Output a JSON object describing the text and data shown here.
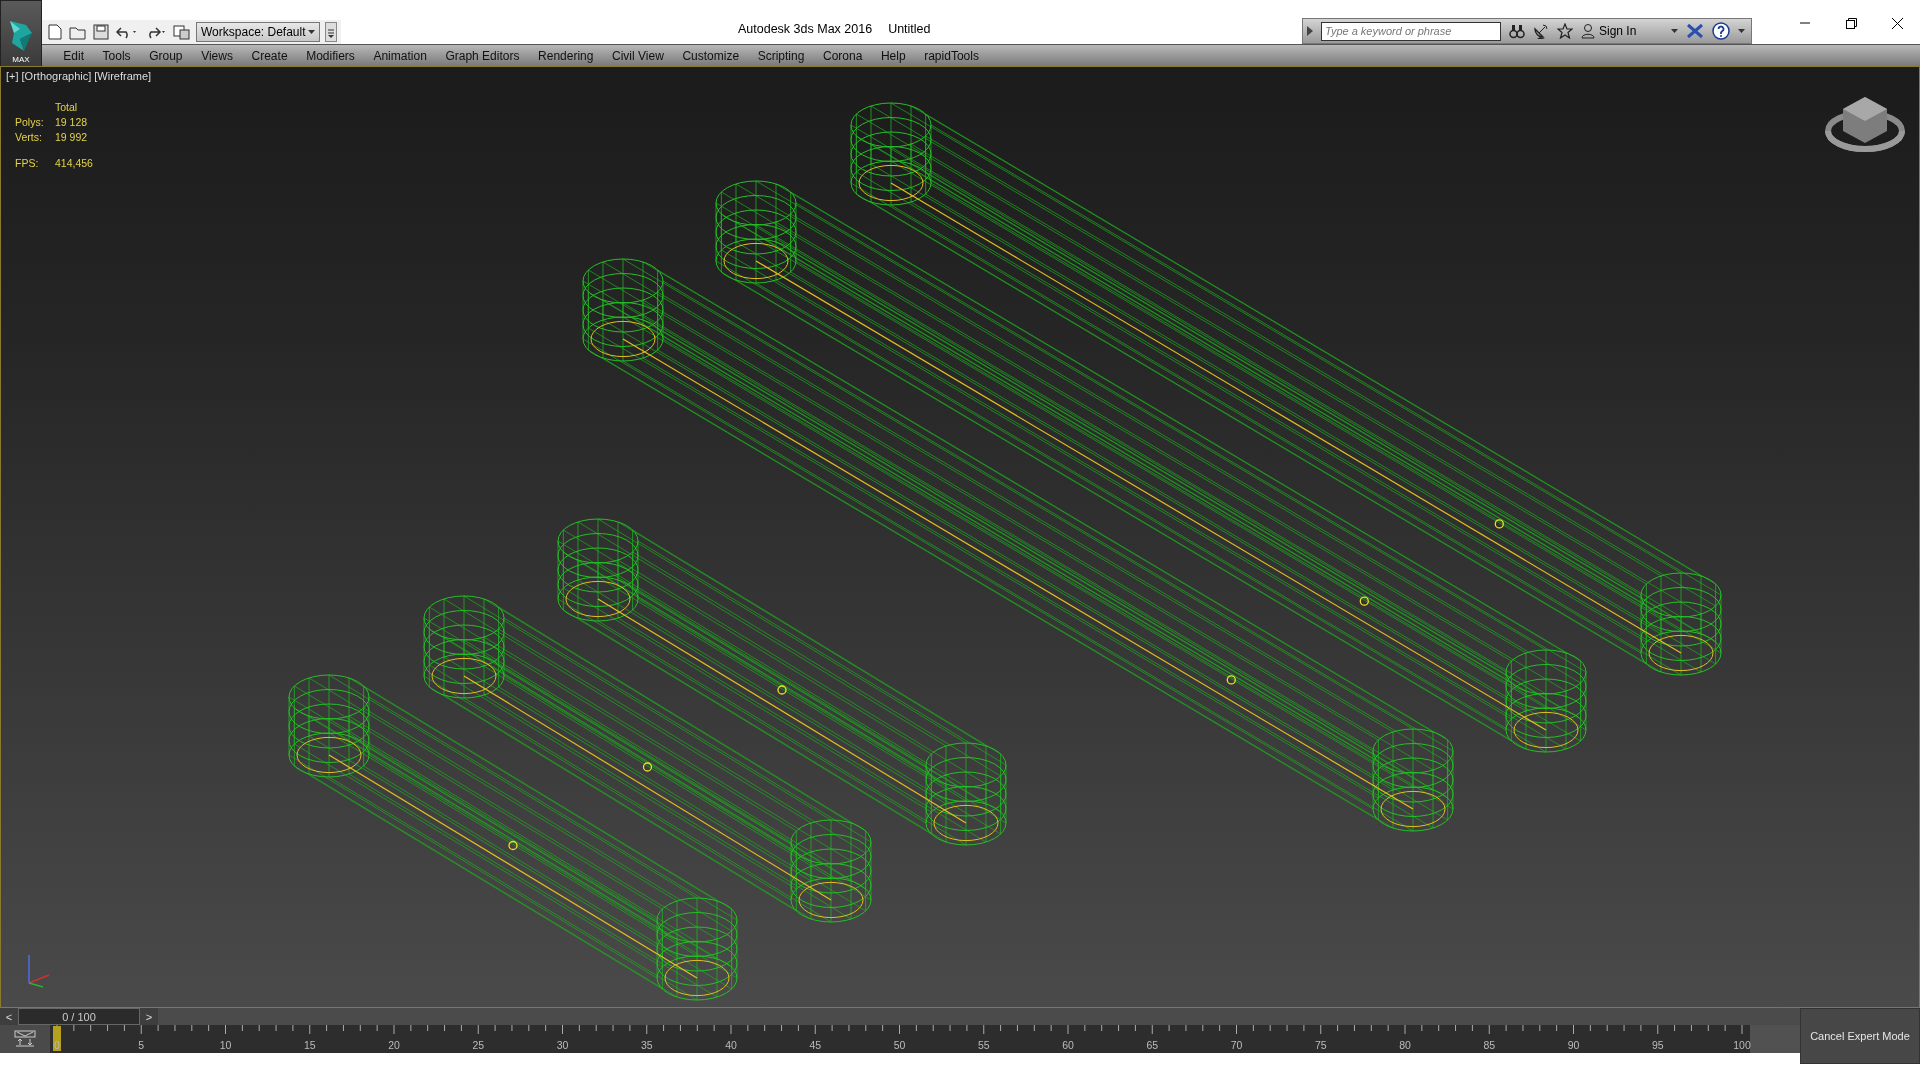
{
  "app_button": {
    "label": "MAX"
  },
  "title_bar": {
    "app_title": "Autodesk 3ds Max 2016",
    "document_title": "Untitled",
    "workspace": "Workspace: Default",
    "search_placeholder": "Type a keyword or phrase",
    "sign_in": "Sign In"
  },
  "menu": [
    "Edit",
    "Tools",
    "Group",
    "Views",
    "Create",
    "Modifiers",
    "Animation",
    "Graph Editors",
    "Rendering",
    "Civil View",
    "Customize",
    "Scripting",
    "Corona",
    "Help",
    "rapidTools"
  ],
  "viewport": {
    "labels": [
      "[+]",
      "[Orthographic]",
      "[Wireframe]"
    ],
    "stats": {
      "header": "Total",
      "rows": [
        {
          "label": "Polys:",
          "value": "19 128"
        },
        {
          "label": "Verts:",
          "value": "19 992"
        }
      ],
      "fps": {
        "label": "FPS:",
        "value": "414,456"
      }
    }
  },
  "time_slider": {
    "prev": "<",
    "next": ">",
    "label": "0 / 100",
    "level": 0
  },
  "track_bar": {
    "ticks": [
      "0",
      "5",
      "10",
      "15",
      "20",
      "25",
      "30",
      "35",
      "40",
      "45",
      "50",
      "55",
      "60",
      "65",
      "70",
      "75",
      "80",
      "85",
      "90",
      "95",
      "100"
    ]
  },
  "cancel_button": "Cancel Expert Mode"
}
